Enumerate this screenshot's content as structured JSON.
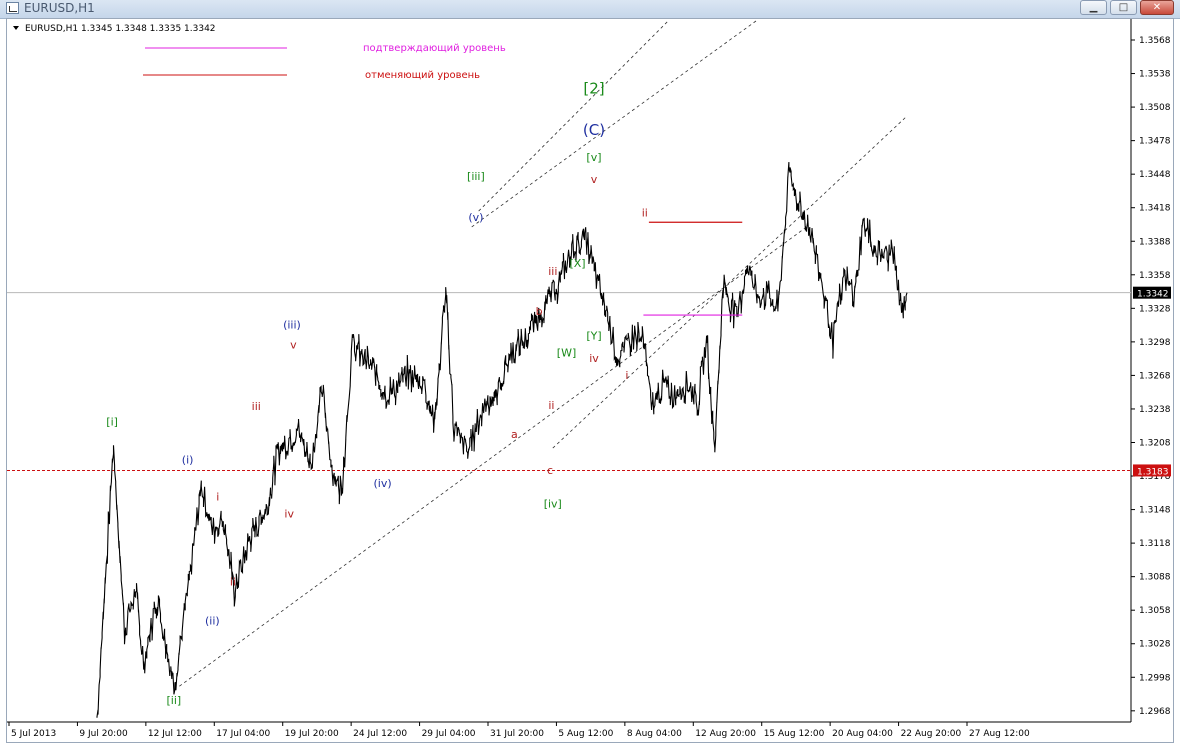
{
  "window": {
    "title": "EURUSD,H1"
  },
  "header": {
    "symbol_line": "EURUSD,H1  1.3345 1.3348 1.3335 1.3342"
  },
  "legend": [
    {
      "text": "подтверждающий уровень",
      "color": "#e020e0"
    },
    {
      "text": "отменяющий уровень",
      "color": "#cc1010"
    }
  ],
  "chart_data": {
    "type": "line",
    "series_kind": "price line",
    "symbol": "EURUSD",
    "timeframe": "H1",
    "ohlc": {
      "open": 1.3345,
      "high": 1.3348,
      "low": 1.3335,
      "close": 1.3342
    },
    "y_ticks": [
      "1.3568",
      "1.3538",
      "1.3508",
      "1.3478",
      "1.3448",
      "1.3418",
      "1.3388",
      "1.3358",
      "1.3328",
      "1.3298",
      "1.3268",
      "1.3238",
      "1.3208",
      "1.3178",
      "1.3148",
      "1.3118",
      "1.3088",
      "1.3058",
      "1.3028",
      "1.2998",
      "1.2968"
    ],
    "ylim": [
      1.2958,
      1.3585
    ],
    "x_ticks": [
      "5 Jul 2013",
      "9 Jul 20:00",
      "12 Jul 12:00",
      "17 Jul 04:00",
      "19 Jul 20:00",
      "24 Jul 12:00",
      "29 Jul 04:00",
      "31 Jul 20:00",
      "5 Aug 12:00",
      "8 Aug 04:00",
      "12 Aug 20:00",
      "15 Aug 12:00",
      "20 Aug 04:00",
      "22 Aug 20:00",
      "27 Aug 12:00"
    ],
    "current_price": {
      "value": 1.3342,
      "label": "1.3342"
    },
    "level_marker": {
      "value": 1.3183,
      "label": "1.3183",
      "color": "#cc1010"
    },
    "swing_points": [
      {
        "x": 0.0,
        "y": 1.2962
      },
      {
        "x": 0.6,
        "y": 1.3205
      },
      {
        "x": 1.0,
        "y": 1.304
      },
      {
        "x": 1.4,
        "y": 1.3075
      },
      {
        "x": 1.7,
        "y": 1.301
      },
      {
        "x": 2.2,
        "y": 1.307
      },
      {
        "x": 2.8,
        "y": 1.299
      },
      {
        "x": 3.4,
        "y": 1.309
      },
      {
        "x": 3.8,
        "y": 1.317
      },
      {
        "x": 4.2,
        "y": 1.313
      },
      {
        "x": 4.6,
        "y": 1.314
      },
      {
        "x": 5.0,
        "y": 1.3075
      },
      {
        "x": 5.6,
        "y": 1.3125
      },
      {
        "x": 6.2,
        "y": 1.315
      },
      {
        "x": 6.6,
        "y": 1.32
      },
      {
        "x": 7.3,
        "y": 1.322
      },
      {
        "x": 7.8,
        "y": 1.319
      },
      {
        "x": 8.2,
        "y": 1.3255
      },
      {
        "x": 8.6,
        "y": 1.318
      },
      {
        "x": 8.9,
        "y": 1.3165
      },
      {
        "x": 9.3,
        "y": 1.3295
      },
      {
        "x": 10.0,
        "y": 1.3275
      },
      {
        "x": 10.6,
        "y": 1.325
      },
      {
        "x": 11.3,
        "y": 1.3268
      },
      {
        "x": 11.9,
        "y": 1.3262
      },
      {
        "x": 12.3,
        "y": 1.3225
      },
      {
        "x": 12.7,
        "y": 1.3345
      },
      {
        "x": 13.0,
        "y": 1.322
      },
      {
        "x": 13.5,
        "y": 1.32
      },
      {
        "x": 14.2,
        "y": 1.3248
      },
      {
        "x": 14.5,
        "y": 1.3245
      },
      {
        "x": 15.0,
        "y": 1.3285
      },
      {
        "x": 15.6,
        "y": 1.33
      },
      {
        "x": 16.2,
        "y": 1.3325
      },
      {
        "x": 16.8,
        "y": 1.335
      },
      {
        "x": 17.4,
        "y": 1.3385
      },
      {
        "x": 17.8,
        "y": 1.339
      },
      {
        "x": 18.3,
        "y": 1.3345
      },
      {
        "x": 18.6,
        "y": 1.3322
      },
      {
        "x": 19.0,
        "y": 1.328
      },
      {
        "x": 19.5,
        "y": 1.3305
      },
      {
        "x": 19.9,
        "y": 1.33
      },
      {
        "x": 20.2,
        "y": 1.3238
      },
      {
        "x": 20.6,
        "y": 1.326
      },
      {
        "x": 21.0,
        "y": 1.325
      },
      {
        "x": 21.5,
        "y": 1.3262
      },
      {
        "x": 21.9,
        "y": 1.3245
      },
      {
        "x": 22.2,
        "y": 1.33
      },
      {
        "x": 22.5,
        "y": 1.3203
      },
      {
        "x": 22.8,
        "y": 1.335
      },
      {
        "x": 23.3,
        "y": 1.332
      },
      {
        "x": 23.7,
        "y": 1.337
      },
      {
        "x": 24.0,
        "y": 1.334
      },
      {
        "x": 24.5,
        "y": 1.334
      },
      {
        "x": 24.8,
        "y": 1.3325
      },
      {
        "x": 25.2,
        "y": 1.3448
      },
      {
        "x": 25.6,
        "y": 1.342
      },
      {
        "x": 26.0,
        "y": 1.3395
      },
      {
        "x": 26.4,
        "y": 1.3352
      },
      {
        "x": 26.8,
        "y": 1.33
      },
      {
        "x": 27.2,
        "y": 1.3355
      },
      {
        "x": 27.6,
        "y": 1.334
      },
      {
        "x": 27.9,
        "y": 1.3405
      },
      {
        "x": 28.3,
        "y": 1.3382
      },
      {
        "x": 28.7,
        "y": 1.3375
      },
      {
        "x": 29.0,
        "y": 1.338
      },
      {
        "x": 29.3,
        "y": 1.332
      },
      {
        "x": 29.5,
        "y": 1.3342
      }
    ],
    "x_span": 29.5,
    "wave_labels": [
      {
        "text": "[i]",
        "x": 0.55,
        "y": 1.3223,
        "color": "#1a8a1a"
      },
      {
        "text": "[ii]",
        "x": 2.8,
        "y": 1.2974,
        "color": "#1a8a1a"
      },
      {
        "text": "(i)",
        "x": 3.3,
        "y": 1.3189,
        "color": "#2030a0"
      },
      {
        "text": "(ii)",
        "x": 4.2,
        "y": 1.3045,
        "color": "#2030a0"
      },
      {
        "text": "i",
        "x": 4.4,
        "y": 1.3156,
        "color": "#b02020"
      },
      {
        "text": "ii",
        "x": 4.95,
        "y": 1.308,
        "color": "#b02020"
      },
      {
        "text": "iii",
        "x": 5.8,
        "y": 1.3237,
        "color": "#b02020"
      },
      {
        "text": "iv",
        "x": 7.0,
        "y": 1.3141,
        "color": "#b02020"
      },
      {
        "text": "(iii)",
        "x": 7.1,
        "y": 1.331,
        "color": "#2030a0"
      },
      {
        "text": "v",
        "x": 7.15,
        "y": 1.3292,
        "color": "#b02020"
      },
      {
        "text": "(iv)",
        "x": 10.4,
        "y": 1.3168,
        "color": "#2030a0"
      },
      {
        "text": "[iii]",
        "x": 13.8,
        "y": 1.3443,
        "color": "#1a8a1a"
      },
      {
        "text": "(v)",
        "x": 13.8,
        "y": 1.3406,
        "color": "#2030a0"
      },
      {
        "text": "a",
        "x": 15.2,
        "y": 1.3212,
        "color": "#b02020"
      },
      {
        "text": "b",
        "x": 16.1,
        "y": 1.3322,
        "color": "#b02020"
      },
      {
        "text": "iii",
        "x": 16.6,
        "y": 1.3358,
        "color": "#b02020"
      },
      {
        "text": "ii",
        "x": 16.55,
        "y": 1.3238,
        "color": "#b02020"
      },
      {
        "text": "c",
        "x": 16.5,
        "y": 1.318,
        "color": "#b02020"
      },
      {
        "text": "[iv]",
        "x": 16.6,
        "y": 1.315,
        "color": "#1a8a1a"
      },
      {
        "text": "[W]",
        "x": 17.1,
        "y": 1.3285,
        "color": "#1a8a1a"
      },
      {
        "text": "[X]",
        "x": 17.5,
        "y": 1.3365,
        "color": "#1a8a1a"
      },
      {
        "text": "[Y]",
        "x": 18.1,
        "y": 1.33,
        "color": "#1a8a1a"
      },
      {
        "text": "iv",
        "x": 18.1,
        "y": 1.328,
        "color": "#b02020"
      },
      {
        "text": "[v]",
        "x": 18.1,
        "y": 1.346,
        "color": "#1a8a1a"
      },
      {
        "text": "v",
        "x": 18.1,
        "y": 1.344,
        "color": "#b02020"
      },
      {
        "text": "(C)",
        "x": 18.1,
        "y": 1.3483,
        "color": "#2030a0"
      },
      {
        "text": "[2]",
        "x": 18.1,
        "y": 1.352,
        "color": "#1a8a1a"
      },
      {
        "text": "ii",
        "x": 19.95,
        "y": 1.341,
        "color": "#b02020"
      },
      {
        "text": "i",
        "x": 19.3,
        "y": 1.3265,
        "color": "#b02020"
      }
    ],
    "channel_lines": [
      {
        "x1": 3.0,
        "y1": 1.299,
        "x2": 25.8,
        "y2": 1.34,
        "style": "dashed"
      },
      {
        "x1": 13.9,
        "y1": 1.3415,
        "x2": 20.8,
        "y2": 1.3585,
        "style": "dashed"
      },
      {
        "x1": 16.6,
        "y1": 1.3203,
        "x2": 29.5,
        "y2": 1.35,
        "style": "dashed"
      },
      {
        "x1": 24.0,
        "y1": 1.3585,
        "x2": 13.6,
        "y2": 1.34,
        "style": "dashed"
      }
    ],
    "level_segments": [
      {
        "x1": 20.1,
        "x2": 23.5,
        "y": 1.3405,
        "color": "#cc1010"
      },
      {
        "x1": 19.9,
        "x2": 23.5,
        "y": 1.3322,
        "color": "#e020e0"
      }
    ],
    "grid": false
  }
}
